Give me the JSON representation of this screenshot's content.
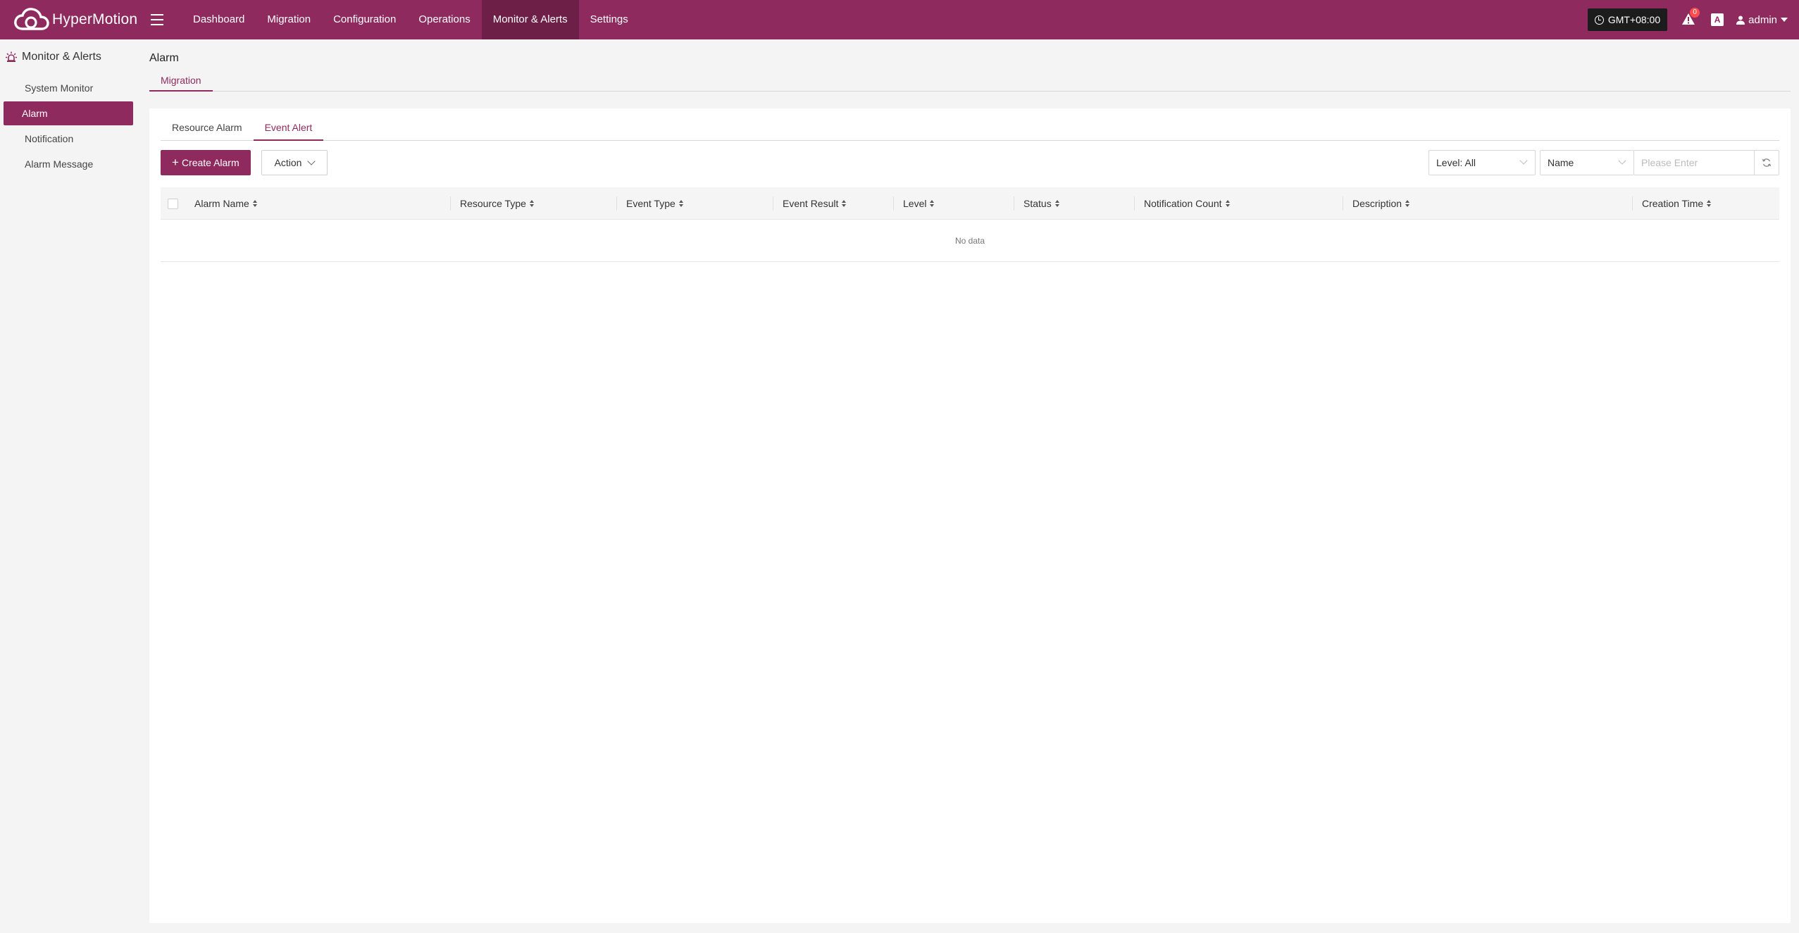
{
  "brand": {
    "name": "HyperMotion",
    "logo_icon": "cloud-logo-icon"
  },
  "nav": {
    "items": [
      {
        "label": "Dashboard",
        "active": false
      },
      {
        "label": "Migration",
        "active": false
      },
      {
        "label": "Configuration",
        "active": false
      },
      {
        "label": "Operations",
        "active": false
      },
      {
        "label": "Monitor & Alerts",
        "active": true
      },
      {
        "label": "Settings",
        "active": false
      }
    ]
  },
  "topright": {
    "timezone": "GMT+08:00",
    "alert_count": "0",
    "lang_label": "A",
    "user": "admin"
  },
  "sidebar": {
    "title": "Monitor & Alerts",
    "items": [
      {
        "label": "System Monitor",
        "active": false
      },
      {
        "label": "Alarm",
        "active": true
      },
      {
        "label": "Notification",
        "active": false
      },
      {
        "label": "Alarm Message",
        "active": false
      }
    ]
  },
  "page": {
    "title": "Alarm",
    "module_tab": "Migration",
    "sub_tabs": [
      {
        "label": "Resource Alarm",
        "active": false
      },
      {
        "label": "Event Alert",
        "active": true
      }
    ]
  },
  "toolbar": {
    "create_label": "Create Alarm",
    "action_label": "Action",
    "level_select": "Level: All",
    "search_field": "Name",
    "search_placeholder": "Please Enter"
  },
  "table": {
    "columns": [
      "Alarm Name",
      "Resource Type",
      "Event Type",
      "Event Result",
      "Level",
      "Status",
      "Notification Count",
      "Description",
      "Creation Time"
    ],
    "rows": [],
    "empty_text": "No data"
  },
  "colors": {
    "brand": "#8f2a5f",
    "brand_dark": "#6e1f48",
    "badge": "#ff4d4f"
  }
}
